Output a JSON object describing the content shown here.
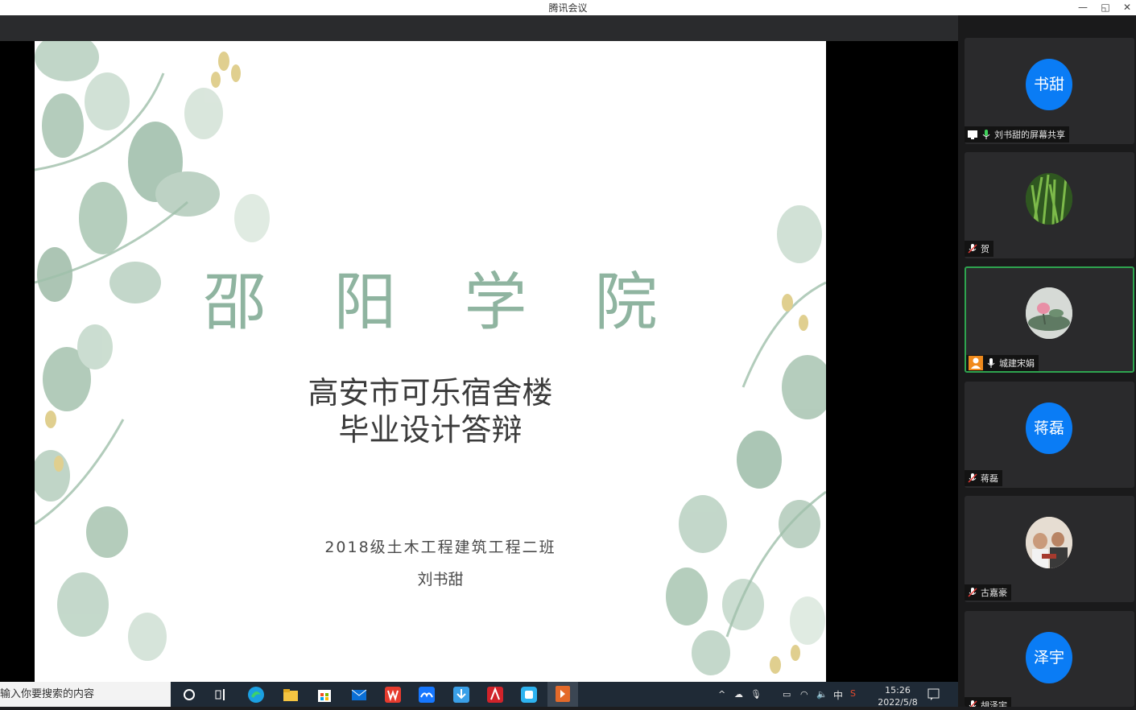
{
  "window": {
    "title": "腾讯会议",
    "minimize": "—",
    "restore": "◱",
    "close": "✕"
  },
  "slide": {
    "title_chars": [
      "邵",
      "阳",
      "学",
      "院"
    ],
    "subtitle_line1": "高安市可乐宿舍楼",
    "subtitle_line2": "毕业设计答辩",
    "class_line": "2018级土木工程建筑工程二班",
    "author": "刘书甜"
  },
  "participants": [
    {
      "avatar_text": "书甜",
      "avatar_kind": "blue",
      "name": "刘书甜的屏幕共享",
      "mic": "mic-on-icon",
      "extra": "screen-share-icon"
    },
    {
      "avatar_text": "",
      "avatar_kind": "grass-photo",
      "name": "贺",
      "mic": "mic-muted-icon"
    },
    {
      "avatar_text": "",
      "avatar_kind": "flower-photo",
      "name": "城建宋娟",
      "mic": "mic-on-icon",
      "extra": "host-icon",
      "active": true
    },
    {
      "avatar_text": "蒋磊",
      "avatar_kind": "blue",
      "name": "蒋磊",
      "mic": "mic-muted-icon"
    },
    {
      "avatar_text": "",
      "avatar_kind": "people-photo",
      "name": "古嘉豪",
      "mic": "mic-muted-icon"
    },
    {
      "avatar_text": "泽宇",
      "avatar_kind": "blue",
      "name": "胡泽宇",
      "mic": "mic-muted-icon"
    }
  ],
  "taskbar": {
    "search_placeholder": "输入你要搜索的内容",
    "apps": [
      "cortana-icon",
      "task-view-icon",
      "edge-icon",
      "file-explorer-icon",
      "store-icon",
      "mail-icon",
      "wps-icon",
      "tencent-meeting-icon",
      "download-icon",
      "acrobat-icon",
      "app-icon",
      "powerpoint-icon"
    ],
    "ime": "中",
    "time": "15:26",
    "date": "2022/5/8"
  },
  "colors": {
    "title_green": "#8fb4a0",
    "avatar_blue": "#0a7cf5",
    "active_border": "#2ea44f"
  }
}
